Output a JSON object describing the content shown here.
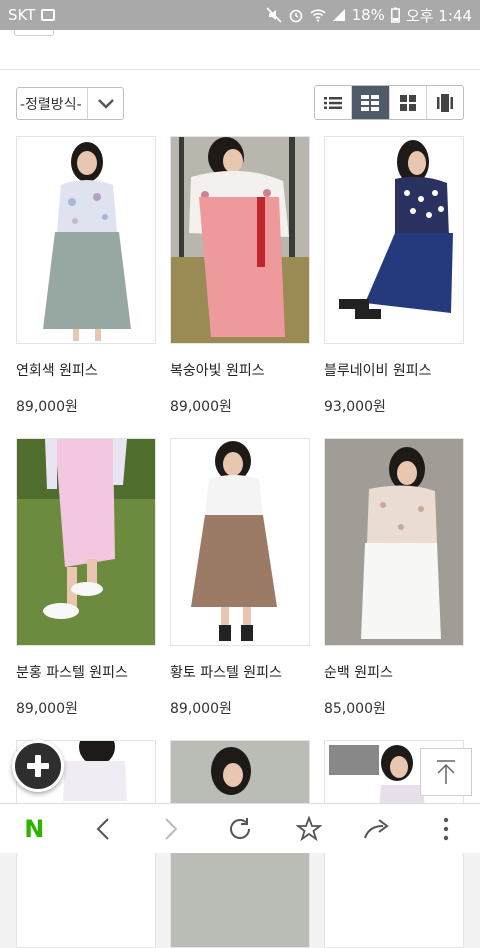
{
  "status_bar": {
    "carrier": "SKT",
    "battery": "18%",
    "time": "오후 1:44"
  },
  "toolbar": {
    "sort_label": "-정렬방식-",
    "view_options": [
      "list-view",
      "grid-view-2",
      "grid-view-4",
      "gallery-view"
    ],
    "active_view": "grid-view-2"
  },
  "products": [
    {
      "name": "연회색 원피스",
      "price": "89,000원"
    },
    {
      "name": "복숭아빛 원피스",
      "price": "89,000원"
    },
    {
      "name": "블루네이비 원피스",
      "price": "93,000원"
    },
    {
      "name": "분홍 파스텔 원피스",
      "price": "89,000원"
    },
    {
      "name": "황토 파스텔 원피스",
      "price": "89,000원"
    },
    {
      "name": "순백 원피스",
      "price": "85,000원"
    }
  ],
  "colors": {
    "active_view_bg": "#4f5b6b",
    "naver_green": "#2db400",
    "status_bar_bg": "#a9a9a9"
  }
}
